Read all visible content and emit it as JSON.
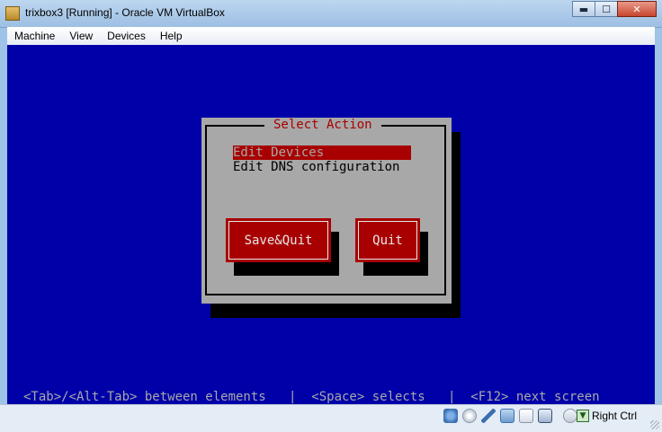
{
  "window": {
    "title": "trixbox3 [Running] - Oracle VM VirtualBox",
    "controls": {
      "minimize": "▬",
      "maximize": "☐",
      "close": "✕"
    }
  },
  "menu": [
    "Machine",
    "View",
    "Devices",
    "Help"
  ],
  "dialog": {
    "title": "Select Action",
    "items": [
      "Edit Devices",
      "Edit DNS configuration"
    ],
    "selected_index": 0,
    "buttons": {
      "save_quit": "Save&Quit",
      "quit": "Quit"
    }
  },
  "helpline": "<Tab>/<Alt-Tab> between elements   |  <Space> selects   |  <F12> next screen",
  "statusbar": {
    "icons": [
      "hard-disk-icon",
      "cd-icon",
      "usb-icon",
      "network-icon",
      "shared-folder-icon",
      "display-icon",
      "mouse-capture-icon"
    ],
    "host_key": "Right Ctrl"
  },
  "colors": {
    "screen_bg": "#0000a8",
    "dialog_bg": "#a8a8a8",
    "accent_red": "#a80000"
  }
}
